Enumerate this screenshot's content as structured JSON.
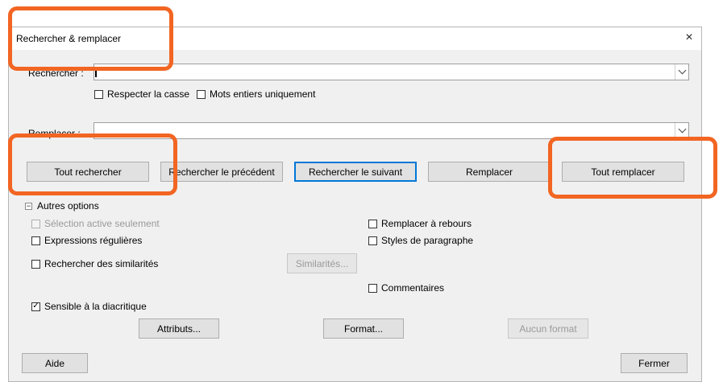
{
  "background": {
    "text": "__ ______ ___ __________ ______ ____"
  },
  "dialog": {
    "title": "Rechercher & remplacer",
    "close_glyph": "×"
  },
  "search": {
    "label": "Rechercher :",
    "value": ""
  },
  "options_row": {
    "match_case": "Respecter la casse",
    "whole_words": "Mots entiers uniquement"
  },
  "replace": {
    "label": "Remplacer :",
    "value": ""
  },
  "buttons": {
    "find_all": "Tout rechercher",
    "find_previous": "Rechercher le précédent",
    "find_next": "Rechercher le suivant",
    "replace": "Remplacer",
    "replace_all": "Tout remplacer"
  },
  "other_options": {
    "header": "Autres options",
    "expander_glyph": "−",
    "current_selection_only": "Sélection active seulement",
    "regular_expressions": "Expressions régulières",
    "similarity_search": "Rechercher des similarités",
    "similarities_button": "Similarités...",
    "replace_backwards": "Remplacer à rebours",
    "paragraph_styles": "Styles de paragraphe",
    "comments": "Commentaires",
    "diacritic_sensitive": "Sensible à la diacritique",
    "attributes_button": "Attributs...",
    "format_button": "Format...",
    "no_format_button": "Aucun format"
  },
  "footer": {
    "help": "Aide",
    "close": "Fermer"
  },
  "states": {
    "diacritic_checked": "✓"
  },
  "colors": {
    "highlight": "#f26522",
    "default_button_border": "#0078d7"
  }
}
